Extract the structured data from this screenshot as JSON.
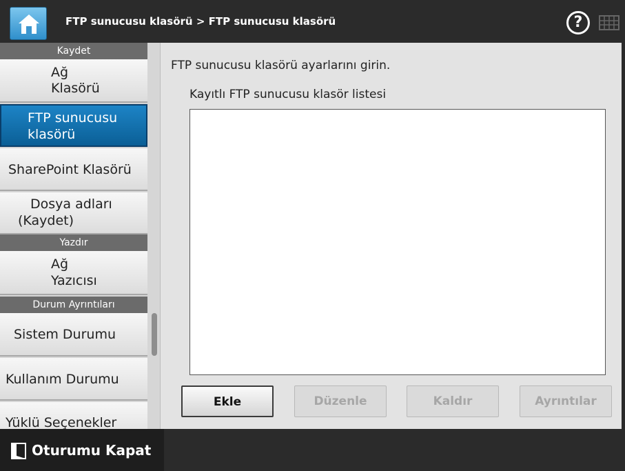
{
  "header": {
    "breadcrumb": "FTP sunucusu klasörü > FTP sunucusu klasörü",
    "help_symbol": "?",
    "icons": [
      "home-icon",
      "help-icon",
      "keyboard-icon"
    ]
  },
  "sidebar": {
    "sections": [
      {
        "header": "Kaydet",
        "items": [
          {
            "line1": "Ağ",
            "line2": "Klasörü"
          },
          {
            "line1": "FTP sunucusu",
            "line2": "klasörü",
            "active": true
          },
          {
            "line1": "SharePoint Klasörü"
          },
          {
            "line1": "Dosya adları",
            "line2": "(Kaydet)"
          }
        ]
      },
      {
        "header": "Yazdır",
        "items": [
          {
            "line1": "Ağ",
            "line2": "Yazıcısı"
          }
        ]
      },
      {
        "header": "Durum Ayrıntıları",
        "items": [
          {
            "line1": "Sistem Durumu"
          },
          {
            "line1": "Kullanım Durumu"
          },
          {
            "line1": "Yüklü Seçenekler"
          }
        ]
      }
    ]
  },
  "main": {
    "intro": "FTP sunucusu klasörü ayarlarını girin.",
    "list_label": "Kayıtlı FTP sunucusu klasör listesi",
    "buttons": {
      "add": "Ekle",
      "edit": "Düzenle",
      "remove": "Kaldır",
      "details": "Ayrıntılar"
    }
  },
  "footer": {
    "logout": "Oturumu Kapat"
  },
  "colors": {
    "active_item": "#0b6aa6",
    "header_bg": "#2b2b2b",
    "panel_bg": "#e3e3e3"
  }
}
